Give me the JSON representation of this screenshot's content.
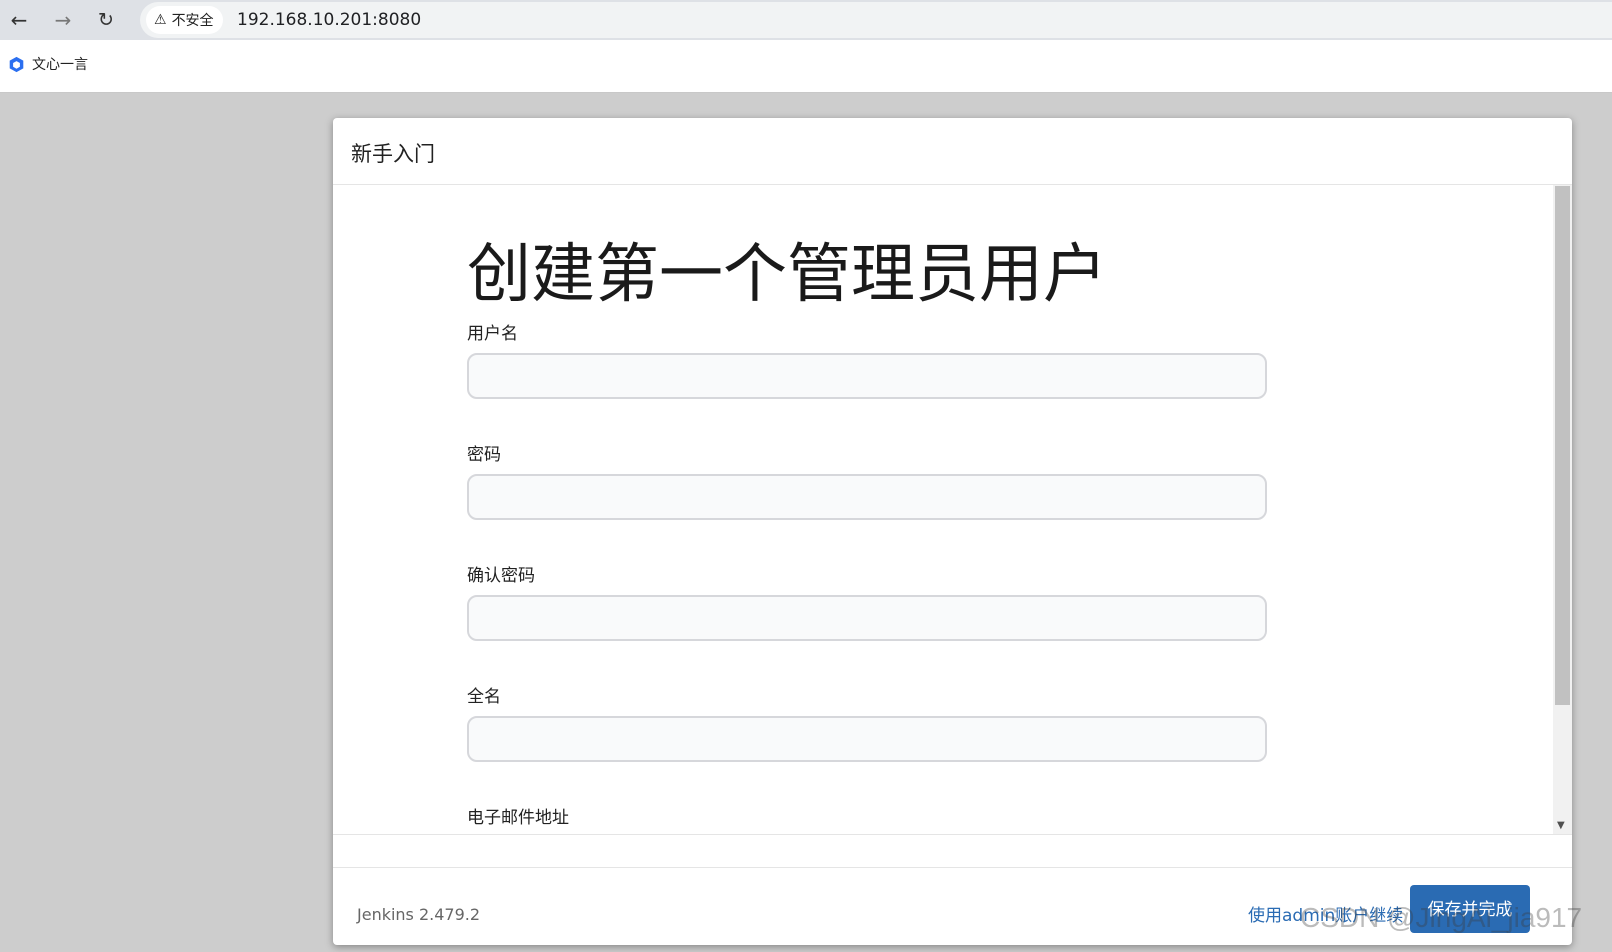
{
  "browser": {
    "security_label": "不安全",
    "url": "192.168.10.201:8080",
    "bookmark_label": "文心一言"
  },
  "modal": {
    "title": "新手入门",
    "heading": "创建第一个管理员用户",
    "fields": [
      {
        "label": "用户名",
        "value": ""
      },
      {
        "label": "密码",
        "value": ""
      },
      {
        "label": "确认密码",
        "value": ""
      },
      {
        "label": "全名",
        "value": ""
      },
      {
        "label": "电子邮件地址",
        "value": ""
      }
    ],
    "footer": {
      "version": "Jenkins 2.479.2",
      "continue_link": "使用admin账户继续",
      "save_button": "保存并完成"
    }
  },
  "watermark": "CSDN @JingAi_jia917",
  "colors": {
    "accent": "#2a6bb3"
  }
}
